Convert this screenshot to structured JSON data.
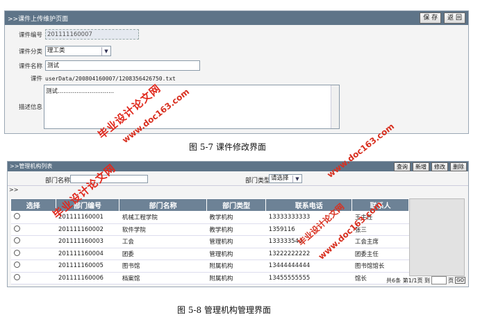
{
  "panel1": {
    "header": ">>课件上传维护页面",
    "btn_save": "保 存",
    "btn_back": "返 回",
    "id_label": "课件编号",
    "id_value": "201111160007",
    "cat_label": "课件分类",
    "cat_value": "理工类",
    "name_label": "课件名称",
    "name_value": "测试",
    "file_label": "课件",
    "file_value": "userData/200804160007/1208356426750.txt",
    "desc_label": "描述信息",
    "desc_value": "测试.............................."
  },
  "caption1": "图 5-7    课件修改界面",
  "panel2": {
    "header": ">>管理机构列表",
    "buttons": {
      "query": "查询",
      "add": "新增",
      "edit": "修改",
      "delete": "删除"
    },
    "dept_name_label": "部门名称",
    "dept_type_label": "部门类型",
    "dept_type_value": "请选择",
    "arrow": ">>",
    "columns": [
      "选择",
      "部门编号",
      "部门名称",
      "部门类型",
      "联系电话",
      "联系人"
    ],
    "rows": [
      [
        "201111160001",
        "机械工程学院",
        "教学机构",
        "13333333333",
        "王主任"
      ],
      [
        "201111160002",
        "软件学院",
        "教学机构",
        "1359116",
        "张三"
      ],
      [
        "201111160003",
        "工会",
        "管理机构",
        "133333544",
        "工会主席"
      ],
      [
        "201111160004",
        "团委",
        "管理机构",
        "13222222222",
        "团委主任"
      ],
      [
        "201111160005",
        "图书馆",
        "附属机构",
        "13444444444",
        "图书馆馆长"
      ],
      [
        "201111160006",
        "档案馆",
        "附属机构",
        "13455555555",
        "馆长"
      ]
    ],
    "footer_total": "共6条 第1/1页 到",
    "footer_page": "页",
    "footer_go": "GO"
  },
  "caption2": "图 5-8    管理机构管理界面",
  "watermark": {
    "text1": "毕业设计论文网",
    "text2": "www.doc163.com"
  }
}
